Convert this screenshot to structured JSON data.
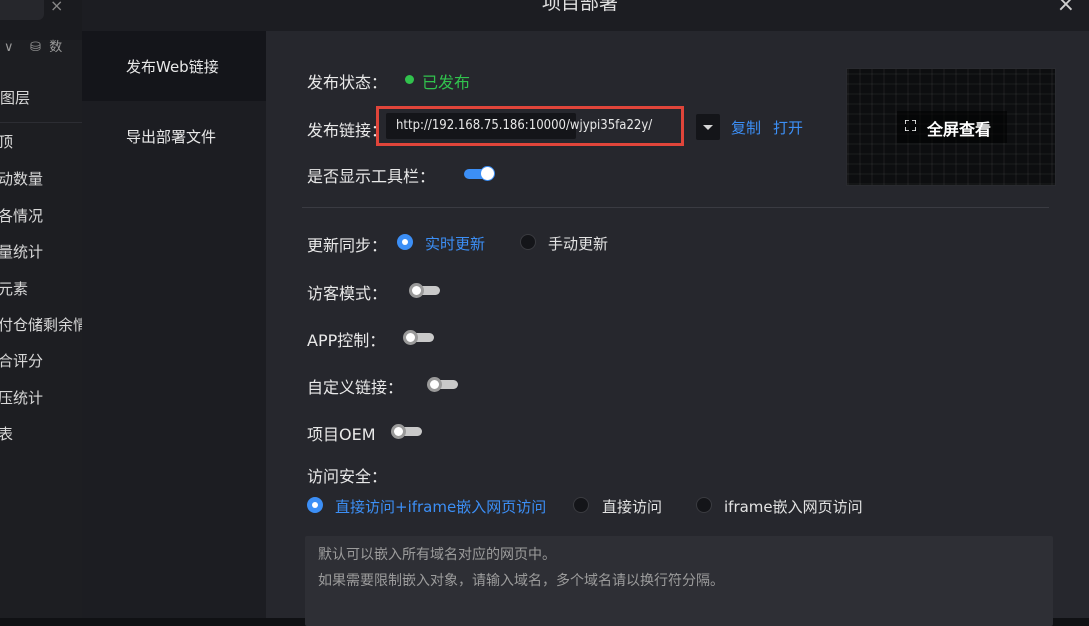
{
  "background_app": {
    "top_label": "数",
    "layers_label": "图层",
    "items": [
      "顶",
      "动数量",
      "各情况",
      "量统计",
      "元素",
      "付仓储剩余情",
      "合评分",
      "压统计",
      "表"
    ]
  },
  "dialog": {
    "title": "项目部署",
    "menu": [
      {
        "label": "发布Web链接",
        "active": true
      },
      {
        "label": "导出部署文件",
        "active": false
      }
    ]
  },
  "publish": {
    "status_label": "发布状态：",
    "status_value": "已发布",
    "link_label": "发布链接：",
    "link_url": "http://192.168.75.186:10000/wjypi35fa22y/",
    "copy_label": "复制",
    "open_label": "打开",
    "toolbar_label": "是否显示工具栏：",
    "toolbar_on": true,
    "fullscreen_label": "全屏查看"
  },
  "settings": {
    "sync_label": "更新同步：",
    "sync_options": [
      {
        "label": "实时更新",
        "selected": true
      },
      {
        "label": "手动更新",
        "selected": false
      }
    ],
    "guest_label": "访客模式：",
    "app_label": "APP控制：",
    "custom_link_label": "自定义链接：",
    "oem_label": "项目OEM",
    "security_label": "访问安全：",
    "security_options": [
      {
        "label": "直接访问+iframe嵌入网页访问",
        "selected": true
      },
      {
        "label": "直接访问",
        "selected": false
      },
      {
        "label": "iframe嵌入网页访问",
        "selected": false
      }
    ],
    "textarea_lines": [
      "默认可以嵌入所有域名对应的网页中。",
      "如果需要限制嵌入对象，请输入域名，多个域名请以换行符分隔。"
    ]
  },
  "colors": {
    "accent": "#3c8ff6",
    "success": "#31c24d",
    "highlight_frame": "#e0453a"
  }
}
